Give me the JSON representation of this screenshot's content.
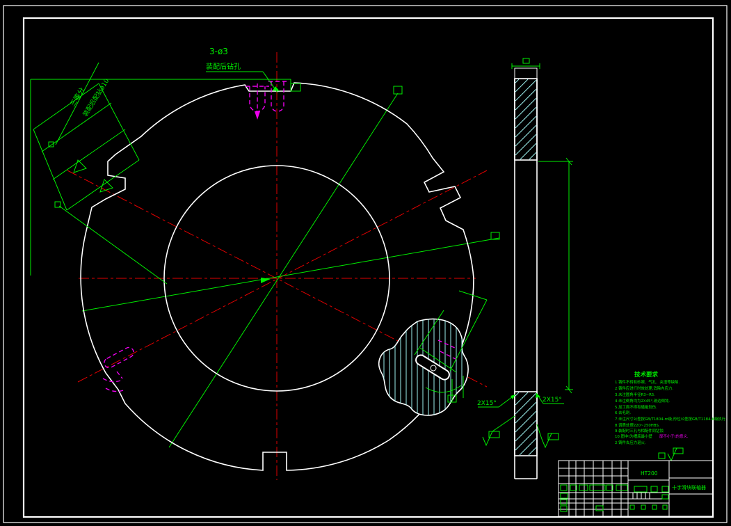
{
  "colors": {
    "background": "#000000",
    "outline": "#ffffff",
    "dimension_green": "#00ee00",
    "centerline_red": "#e00000",
    "hidden_magenta": "#ee00ee",
    "hatch_cyan": "#9ef2ef"
  },
  "annotations": {
    "hole_callout_line1": "3-ø3",
    "hole_callout_line2": "装配后钻孔",
    "left_note_line1": "三等分",
    "left_note_line2": "装配后配钻ø10",
    "side_chamfer_left": "2X15°",
    "side_chamfer_right": "2X15°"
  },
  "tech_notes": {
    "title": "技术要求",
    "lines": [
      "1.铸件不得有砂眼、气孔、夹渣等缺陷.",
      "2.铸件应进行时效处理,消除内应力.",
      "3.未注圆角半径R3~R5.",
      "4.未注倒角均为2X45°,锐边倒钝.",
      "5.加工面不得有磕碰划伤.",
      "6.去毛刺.",
      "7.未注尺寸公差按GB/T1804-m级,形位公差按GB/T1184-K级执行.",
      "8.调质处理220~250HBS.",
      "9.装配时三孔与相配件同钻铰.",
      "10.图中t为槽底最小壁"
    ],
    "magenta_tail": "厚不小于t的意义.",
    "last_line": "2.铸件去应力退火."
  },
  "title_block": {
    "material": "HT200",
    "part_name": "十字滑块联轴器"
  }
}
